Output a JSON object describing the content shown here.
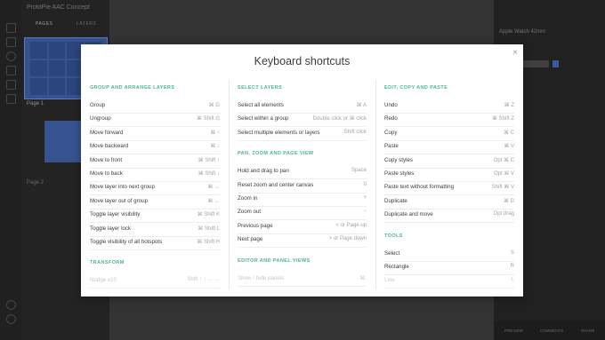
{
  "app": {
    "project_title": "ProtoPie AAC Concept",
    "tabs": [
      "PAGES",
      "LAYERS"
    ],
    "pages": [
      "Page 1",
      "Page 2"
    ],
    "device": "Apple Watch 42mm",
    "bottom_actions": [
      "PREVIEW",
      "COMMENTS",
      "SHARE"
    ]
  },
  "modal": {
    "title": "Keyboard shortcuts",
    "close_glyph": "×",
    "columns": [
      {
        "sections": [
          {
            "heading": "GROUP AND ARRANGE LAYERS",
            "items": [
              {
                "action": "Group",
                "keys": "⌘ G"
              },
              {
                "action": "Ungroup",
                "keys": "⌘ Shift G"
              },
              {
                "action": "Move forward",
                "keys": "⌘ ↑"
              },
              {
                "action": "Move backward",
                "keys": "⌘ ↓"
              },
              {
                "action": "Move to front",
                "keys": "⌘ Shift ↑"
              },
              {
                "action": "Move to back",
                "keys": "⌘ Shift ↓"
              },
              {
                "action": "Move layer into next group",
                "keys": "⌘ →"
              },
              {
                "action": "Move layer out of group",
                "keys": "⌘ ←"
              },
              {
                "action": "Toggle layer visibility",
                "keys": "⌘ Shift K"
              },
              {
                "action": "Toggle layer lock",
                "keys": "⌘ Shift L"
              },
              {
                "action": "Toggle visibility of all hotspots",
                "keys": "⌘ Shift H"
              }
            ]
          },
          {
            "heading": "TRANSFORM",
            "items": [
              {
                "action": "Nudge x10",
                "keys": "Shift ↑ ↓ → ←"
              }
            ]
          }
        ]
      },
      {
        "sections": [
          {
            "heading": "SELECT LAYERS",
            "items": [
              {
                "action": "Select all elements",
                "keys": "⌘ A"
              },
              {
                "action": "Select within a group",
                "keys": "Double click or ⌘ click"
              },
              {
                "action": "Select multiple elements or layers",
                "keys": "Shift click"
              }
            ]
          },
          {
            "heading": "PAN, ZOOM AND PAGE VIEW",
            "items": [
              {
                "action": "Hold and drag to pan",
                "keys": "Space"
              },
              {
                "action": "Reset zoom and center canvas",
                "keys": "0"
              },
              {
                "action": "Zoom in",
                "keys": "+"
              },
              {
                "action": "Zoom out",
                "keys": "−"
              },
              {
                "action": "Previous page",
                "keys": "< or Page up"
              },
              {
                "action": "Next page",
                "keys": "> or Page down"
              }
            ]
          },
          {
            "heading": "EDITOR AND PANEL VIEWS",
            "items": [
              {
                "action": "Show / hide panels",
                "keys": "⌘."
              }
            ]
          }
        ]
      },
      {
        "sections": [
          {
            "heading": "EDIT, COPY AND PASTE",
            "items": [
              {
                "action": "Undo",
                "keys": "⌘ Z"
              },
              {
                "action": "Redo",
                "keys": "⌘ Shift Z"
              },
              {
                "action": "Copy",
                "keys": "⌘ C"
              },
              {
                "action": "Paste",
                "keys": "⌘ V"
              },
              {
                "action": "Copy styles",
                "keys": "Opt ⌘ C"
              },
              {
                "action": "Paste styles",
                "keys": "Opt ⌘ V"
              },
              {
                "action": "Paste text without formatting",
                "keys": "Shift ⌘ V"
              },
              {
                "action": "Duplicate",
                "keys": "⌘ D"
              },
              {
                "action": "Duplicate and move",
                "keys": "Opt drag"
              }
            ]
          },
          {
            "heading": "TOOLS",
            "items": [
              {
                "action": "Select",
                "keys": "S"
              },
              {
                "action": "Rectangle",
                "keys": "R"
              },
              {
                "action": "Line",
                "keys": "L"
              }
            ]
          }
        ]
      }
    ]
  }
}
